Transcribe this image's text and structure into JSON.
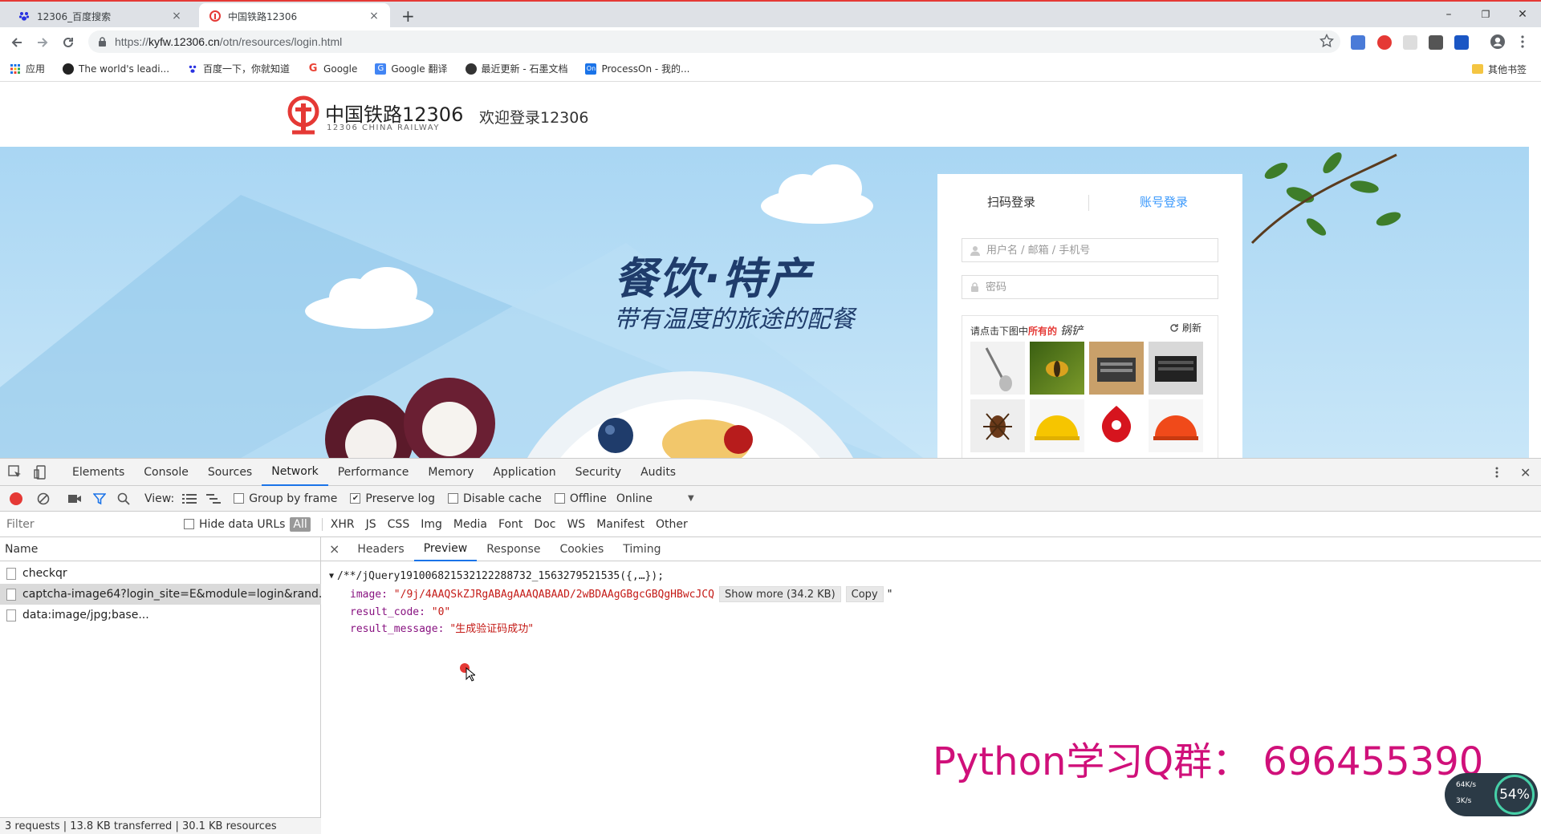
{
  "tabs": [
    {
      "title": "12306_百度搜索",
      "close": "×"
    },
    {
      "title": "中国铁路12306",
      "close": "×"
    }
  ],
  "new_tab": "+",
  "window_controls": {
    "minimize": "–",
    "restore": "❐",
    "close": "✕"
  },
  "address": {
    "scheme": "https://",
    "host": "kyfw.12306.cn",
    "path": "/otn/resources/login.html"
  },
  "bookmarks": [
    {
      "label": "应用",
      "color": "#4285f4"
    },
    {
      "label": "The world's leadi...",
      "color": "#222222"
    },
    {
      "label": "百度一下，你就知道",
      "color": "#2932e1"
    },
    {
      "label": "Google",
      "color": "#ea4335"
    },
    {
      "label": "Google 翻译",
      "color": "#4285f4"
    },
    {
      "label": "最近更新 - 石墨文档",
      "color": "#333333"
    },
    {
      "label": "ProcessOn - 我的...",
      "color": "#1a73e8"
    }
  ],
  "bookmarks_other": "其他书签",
  "page": {
    "logo_title": "中国铁路12306",
    "logo_sub": "12306 CHINA RAILWAY",
    "welcome": "欢迎登录12306",
    "banner_head": "餐饮·特产",
    "banner_sub": "带有温度的旅途的配餐",
    "login_tabs": [
      "扫码登录",
      "账号登录"
    ],
    "username_placeholder": "用户名 / 邮箱 / 手机号",
    "password_placeholder": "密码",
    "captcha_prompt_prefix": "请点击下图中",
    "captcha_prompt_highlight": "所有的",
    "captcha_prompt_word": "锅铲",
    "captcha_refresh": "刷新"
  },
  "devtools": {
    "tabs": [
      "Elements",
      "Console",
      "Sources",
      "Network",
      "Performance",
      "Memory",
      "Application",
      "Security",
      "Audits"
    ],
    "active_tab": "Network",
    "toolbar": {
      "view_label": "View:",
      "group_by_frame": "Group by frame",
      "preserve_log": "Preserve log",
      "disable_cache": "Disable cache",
      "offline": "Offline",
      "throttle": "Online"
    },
    "filter_placeholder": "Filter",
    "hide_data_urls": "Hide data URLs",
    "filter_types": [
      "All",
      "XHR",
      "JS",
      "CSS",
      "Img",
      "Media",
      "Font",
      "Doc",
      "WS",
      "Manifest",
      "Other"
    ],
    "name_header": "Name",
    "requests": [
      "checkqr",
      "captcha-image64?login_site=E&module=login&rand...",
      "data:image/jpg;base..."
    ],
    "summary": "3 requests  |  13.8 KB transferred  |  30.1 KB resources",
    "detail_tabs": [
      "Headers",
      "Preview",
      "Response",
      "Cookies",
      "Timing"
    ],
    "detail_close": "×",
    "preview": {
      "root": "/**/jQuery19100682153212228873​2_1563279521535({,…});",
      "image_key": "image:",
      "image_val": "\"/9j/4AAQSkZJRgABAgAAAQABAAD/2wBDAAgGBgcGBQgHBwcJCQ",
      "show_more": "Show more (34.2 KB)",
      "copy": "Copy",
      "image_end": "\"",
      "code_key": "result_code:",
      "code_val": "\"0\"",
      "msg_key": "result_message:",
      "msg_val": "\"生成验证码成功\""
    }
  },
  "watermark": "Python学习Q群：  696455390",
  "speed_widget": {
    "up": "64K/s",
    "down": "3K/s",
    "percent": "54%"
  }
}
